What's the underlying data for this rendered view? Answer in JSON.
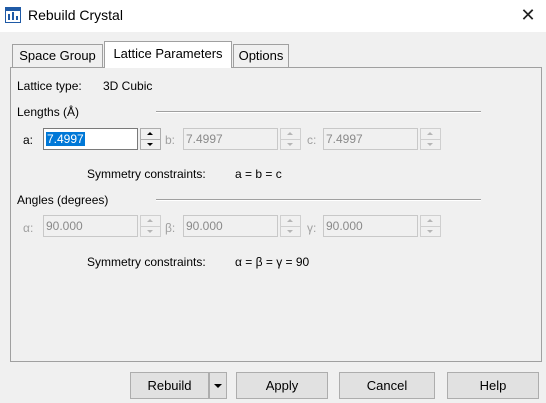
{
  "window": {
    "title": "Rebuild Crystal"
  },
  "tabs": [
    {
      "label": "Space Group"
    },
    {
      "label": "Lattice Parameters"
    },
    {
      "label": "Options"
    }
  ],
  "lattice_type": {
    "label": "Lattice type:",
    "value": "3D Cubic"
  },
  "lengths": {
    "heading": "Lengths (Å)",
    "a": {
      "label": "a:",
      "value": "7.4997"
    },
    "b": {
      "label": "b:",
      "value": "7.4997"
    },
    "c": {
      "label": "c:",
      "value": "7.4997"
    },
    "constraints_label": "Symmetry constraints:",
    "constraints_value": "a = b = c"
  },
  "angles": {
    "heading": "Angles (degrees)",
    "alpha": {
      "label": "α:",
      "value": "90.000"
    },
    "beta": {
      "label": "β:",
      "value": "90.000"
    },
    "gamma": {
      "label": "γ:",
      "value": "90.000"
    },
    "constraints_label": "Symmetry constraints:",
    "constraints_value": "α = β = γ = 90"
  },
  "buttons": {
    "rebuild": "Rebuild",
    "apply": "Apply",
    "cancel": "Cancel",
    "help": "Help"
  },
  "icons": {
    "app": "rebuild-crystal-app-icon",
    "close": "close-icon",
    "spinner": "spinner-arrows-icon",
    "dropdown": "dropdown-arrow-icon"
  },
  "colors": {
    "selection": "#0078d7",
    "dialog_bg": "#f0f0f0",
    "disabled_text": "#a0a0a0"
  }
}
